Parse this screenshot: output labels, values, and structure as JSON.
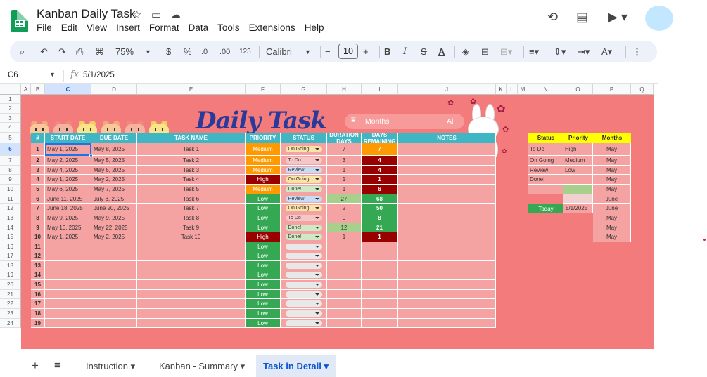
{
  "app": {
    "title": "Kanban Daily Task",
    "menus": [
      "File",
      "Edit",
      "View",
      "Insert",
      "Format",
      "Data",
      "Tools",
      "Extensions",
      "Help"
    ]
  },
  "toolbar": {
    "zoom": "75%",
    "currency": "$",
    "percent": "%",
    "dec_down": ".0",
    "dec_up": ".00",
    "number_format": "123",
    "font": "Calibri",
    "font_size": "10"
  },
  "formula_bar": {
    "cell_ref": "C6",
    "value": "5/1/2025",
    "fx": "fx"
  },
  "columns": [
    "A",
    "B",
    "C",
    "D",
    "E",
    "F",
    "G",
    "H",
    "I",
    "J",
    "K",
    "L",
    "M",
    "N",
    "O",
    "P",
    "Q"
  ],
  "rows": [
    "1",
    "2",
    "3",
    "4",
    "5",
    "6",
    "7",
    "8",
    "9",
    "10",
    "11",
    "12",
    "13",
    "14",
    "15",
    "16",
    "17",
    "18",
    "19",
    "20",
    "21",
    "22",
    "23",
    "24"
  ],
  "sheet": {
    "title": "Daily Task",
    "filter": {
      "label": "Months",
      "value": "All"
    },
    "headers": [
      "#",
      "START DATE",
      "DUE DATE",
      "TASK NAME",
      "PRIORITY",
      "STATUS",
      "DURATION DAYS",
      "DAYS REMAINING",
      "NOTES"
    ],
    "tasks": [
      {
        "n": "1",
        "start": "May 1, 2025",
        "due": "May 8, 2025",
        "name": "Task 1",
        "priority": "Medium",
        "status": "On Going",
        "duration": "7",
        "remaining": "7"
      },
      {
        "n": "2",
        "start": "May 2, 2025",
        "due": "May 5, 2025",
        "name": "Task 2",
        "priority": "Medium",
        "status": "To Do",
        "duration": "3",
        "remaining": "4"
      },
      {
        "n": "3",
        "start": "May 4, 2025",
        "due": "May 5, 2025",
        "name": "Task 3",
        "priority": "Medium",
        "status": "Review",
        "duration": "1",
        "remaining": "4"
      },
      {
        "n": "4",
        "start": "May 1, 2025",
        "due": "May 2, 2025",
        "name": "Task 4",
        "priority": "High",
        "status": "On Going",
        "duration": "1",
        "remaining": "1"
      },
      {
        "n": "5",
        "start": "May 6, 2025",
        "due": "May 7, 2025",
        "name": "Task 5",
        "priority": "Medium",
        "status": "Done!",
        "duration": "1",
        "remaining": "6"
      },
      {
        "n": "6",
        "start": "June 11, 2025",
        "due": "July 8, 2025",
        "name": "Task 6",
        "priority": "Low",
        "status": "Review",
        "duration": "27",
        "remaining": "68"
      },
      {
        "n": "7",
        "start": "June 18, 2025",
        "due": "June 20, 2025",
        "name": "Task 7",
        "priority": "Low",
        "status": "On Going",
        "duration": "2",
        "remaining": "50"
      },
      {
        "n": "8",
        "start": "May 9, 2025",
        "due": "May 9, 2025",
        "name": "Task 8",
        "priority": "Low",
        "status": "To Do",
        "duration": "0",
        "remaining": "8"
      },
      {
        "n": "9",
        "start": "May 10, 2025",
        "due": "May 22, 2025",
        "name": "Task 9",
        "priority": "Low",
        "status": "Done!",
        "duration": "12",
        "remaining": "21"
      },
      {
        "n": "10",
        "start": "May 1, 2025",
        "due": "May 2, 2025",
        "name": "Task 10",
        "priority": "High",
        "status": "Done!",
        "duration": "1",
        "remaining": "1"
      }
    ],
    "empty_rows": [
      {
        "n": "11",
        "priority": "Low"
      },
      {
        "n": "12",
        "priority": "Low"
      },
      {
        "n": "13",
        "priority": "Low"
      },
      {
        "n": "14",
        "priority": "Low"
      },
      {
        "n": "15",
        "priority": "Low"
      },
      {
        "n": "16",
        "priority": "Low"
      },
      {
        "n": "17",
        "priority": "Low"
      },
      {
        "n": "18",
        "priority": "Low"
      },
      {
        "n": "19",
        "priority": "Low"
      }
    ],
    "lookup": {
      "headers": [
        "Status",
        "Priority",
        "Months"
      ],
      "status": [
        "To Do",
        "On Going",
        "Review",
        "Done!"
      ],
      "priority": [
        "High",
        "Medium",
        "Low"
      ],
      "months": [
        "May",
        "May",
        "May",
        "May",
        "May",
        "June",
        "June",
        "May",
        "May",
        "May"
      ],
      "today_label": "Today",
      "today_value": "5/1/2025"
    }
  },
  "tabs": [
    "Instruction",
    "Kanban - Summary",
    "Task in Detail"
  ],
  "colors": {
    "header": "#3fb6c3",
    "background": "#f37b7c",
    "cell": "#f4a2a2",
    "medium": "#ff9900",
    "high": "#990000",
    "low": "#34a853",
    "title": "#2a3a9a"
  }
}
